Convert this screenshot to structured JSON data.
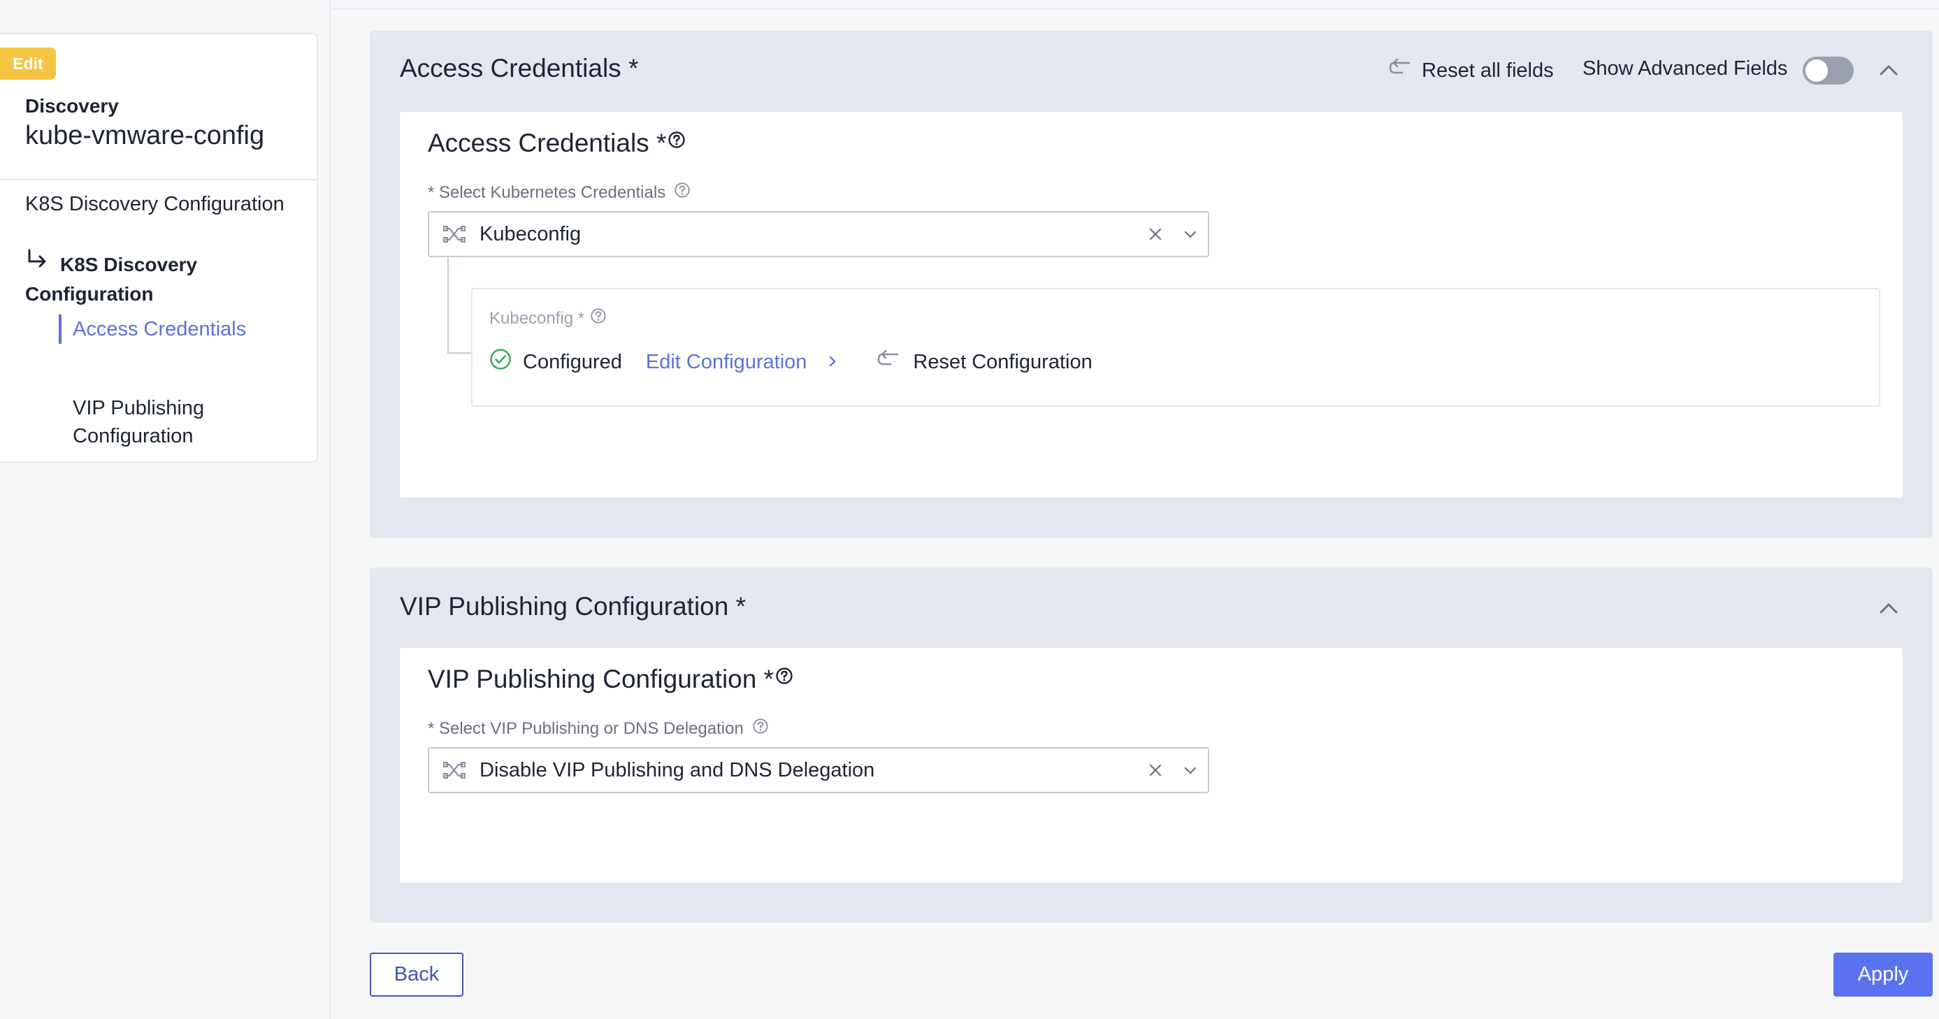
{
  "sidebar": {
    "badge": "Edit",
    "discovery_label": "Discovery",
    "discovery_name": "kube-vmware-config",
    "nav_top": "K8S Discovery Configuration",
    "nav_sub": "K8S Discovery Configuration",
    "nav_active": "Access Credentials",
    "nav_item": "VIP Publishing Configuration"
  },
  "access_section": {
    "title": "Access Credentials *",
    "reset_all": "Reset all fields",
    "advanced_label": "Show Advanced Fields",
    "advanced_enabled": false,
    "inner_title": "Access Credentials *",
    "field_label": "* Select Kubernetes Credentials",
    "selected": "Kubeconfig",
    "kubeconfig": {
      "label": "Kubeconfig *",
      "status": "Configured",
      "edit_link": "Edit Configuration",
      "reset": "Reset Configuration"
    }
  },
  "vip_section": {
    "title": "VIP Publishing Configuration *",
    "inner_title": "VIP Publishing Configuration *",
    "field_label": "* Select VIP Publishing or DNS Delegation",
    "selected": "Disable VIP Publishing and DNS Delegation"
  },
  "footer": {
    "back": "Back",
    "apply": "Apply"
  },
  "colors": {
    "accent": "#5b72d6",
    "badge": "#f5c542",
    "apply": "#5b72f0",
    "success": "#3ba55c"
  }
}
